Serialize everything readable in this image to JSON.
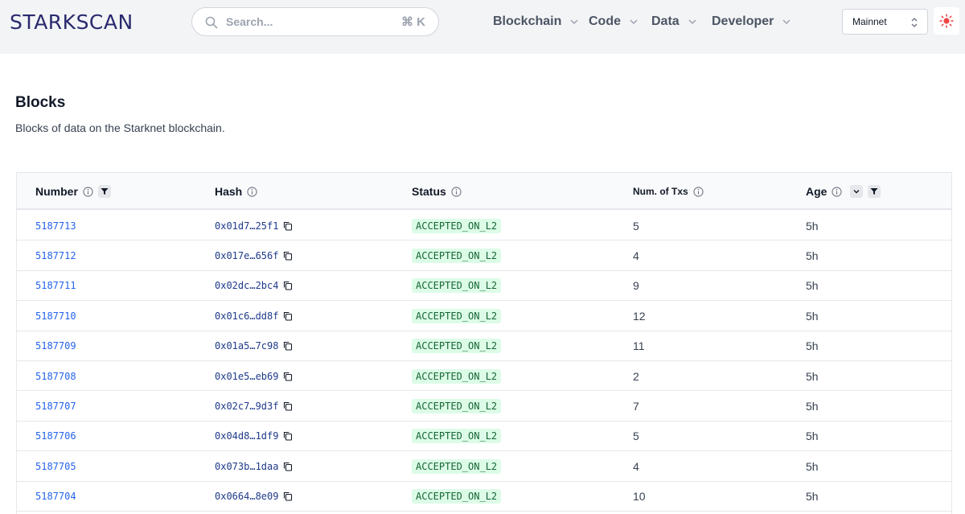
{
  "header": {
    "logo": "STARKSCAN",
    "search_placeholder": "Search...",
    "search_shortcut": "⌘ K",
    "nav": [
      "Blockchain",
      "Code",
      "Data",
      "Developer"
    ],
    "network": "Mainnet"
  },
  "page": {
    "title": "Blocks",
    "subtitle": "Blocks of data on the Starknet blockchain."
  },
  "table": {
    "columns": [
      "Number",
      "Hash",
      "Status",
      "Num. of Txs",
      "Age"
    ],
    "rows": [
      {
        "number": "5187713",
        "hash": "0x01d7…25f1",
        "status": "ACCEPTED_ON_L2",
        "txs": "5",
        "age": "5h"
      },
      {
        "number": "5187712",
        "hash": "0x017e…656f",
        "status": "ACCEPTED_ON_L2",
        "txs": "4",
        "age": "5h"
      },
      {
        "number": "5187711",
        "hash": "0x02dc…2bc4",
        "status": "ACCEPTED_ON_L2",
        "txs": "9",
        "age": "5h"
      },
      {
        "number": "5187710",
        "hash": "0x01c6…dd8f",
        "status": "ACCEPTED_ON_L2",
        "txs": "12",
        "age": "5h"
      },
      {
        "number": "5187709",
        "hash": "0x01a5…7c98",
        "status": "ACCEPTED_ON_L2",
        "txs": "11",
        "age": "5h"
      },
      {
        "number": "5187708",
        "hash": "0x01e5…eb69",
        "status": "ACCEPTED_ON_L2",
        "txs": "2",
        "age": "5h"
      },
      {
        "number": "5187707",
        "hash": "0x02c7…9d3f",
        "status": "ACCEPTED_ON_L2",
        "txs": "7",
        "age": "5h"
      },
      {
        "number": "5187706",
        "hash": "0x04d8…1df9",
        "status": "ACCEPTED_ON_L2",
        "txs": "5",
        "age": "5h"
      },
      {
        "number": "5187705",
        "hash": "0x073b…1daa",
        "status": "ACCEPTED_ON_L2",
        "txs": "4",
        "age": "5h"
      },
      {
        "number": "5187704",
        "hash": "0x0664…8e09",
        "status": "ACCEPTED_ON_L2",
        "txs": "10",
        "age": "5h"
      }
    ]
  },
  "colors": {
    "logo": "#2a2a6e",
    "link": "#2563eb",
    "status_bg": "#dcfce7",
    "status_text": "#166534",
    "header_bg": "#f3f4f6"
  }
}
